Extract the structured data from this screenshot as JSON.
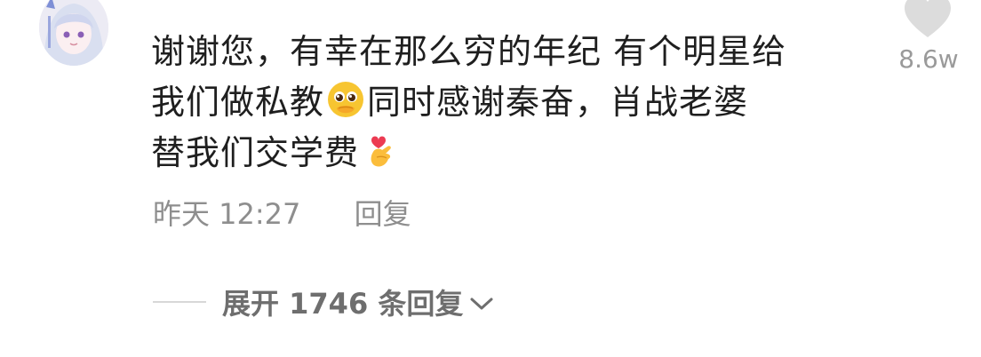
{
  "comment": {
    "username": "",
    "lines": [
      "谢谢您，有幸在那么穷的年纪 有个明星给",
      "我们做私教",
      "同时感谢秦奋，肖战老婆",
      "替我们交学费"
    ],
    "emoji_1": "pleading-face",
    "emoji_2": "heart-fingers",
    "like_count": "8.6w",
    "timestamp": "昨天 12:27",
    "reply_label": "回复",
    "expand_label": "展开 1746 条回复"
  },
  "colors": {
    "text": "#1f1f1f",
    "meta": "#8e8e8e",
    "heart": "#d8d8d8"
  }
}
